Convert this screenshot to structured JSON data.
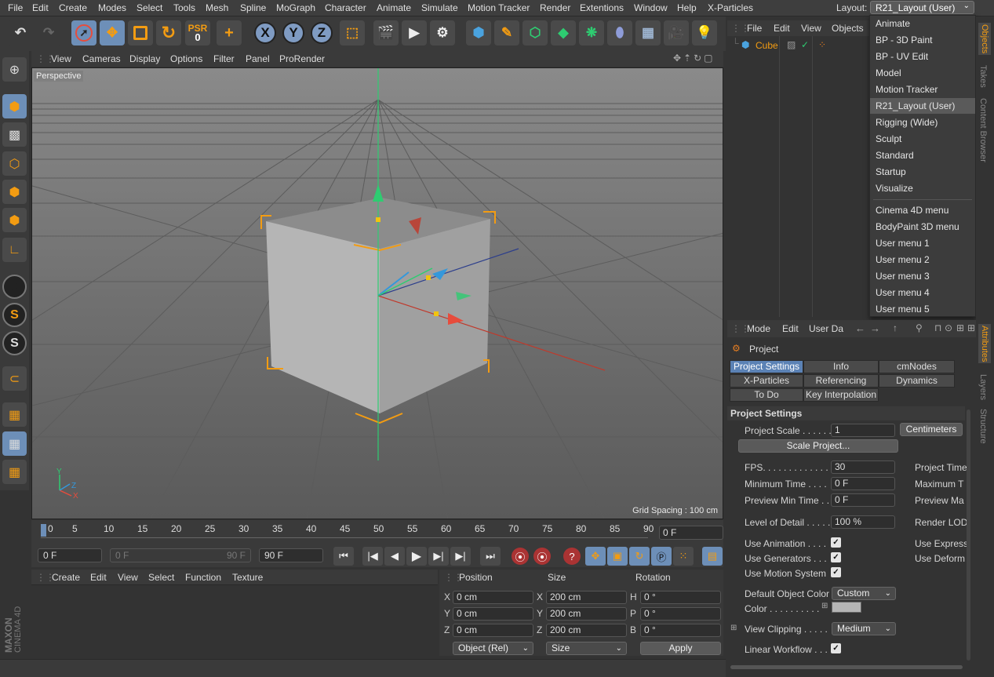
{
  "menubar": {
    "items": [
      "File",
      "Edit",
      "Create",
      "Modes",
      "Select",
      "Tools",
      "Mesh",
      "Spline",
      "MoGraph",
      "Character",
      "Animate",
      "Simulate",
      "Motion Tracker",
      "Render",
      "Extentions",
      "Window",
      "Help",
      "X-Particles"
    ],
    "layout_label": "Layout:",
    "layout_value": "R21_Layout (User)"
  },
  "layout_dropdown": {
    "items": [
      "Animate",
      "BP - 3D Paint",
      "BP - UV Edit",
      "Model",
      "Motion Tracker",
      "R21_Layout (User)",
      "Rigging (Wide)",
      "Sculpt",
      "Standard",
      "Startup",
      "Visualize"
    ],
    "active": "R21_Layout (User)",
    "menus": [
      "Cinema 4D menu",
      "BodyPaint 3D menu",
      "User menu 1",
      "User menu 2",
      "User menu 3",
      "User menu 4",
      "User menu 5"
    ]
  },
  "toolbar": {
    "psr_label": "PSR",
    "psr_value": "0",
    "axis_x": "X",
    "axis_y": "Y",
    "axis_z": "Z"
  },
  "viewport": {
    "menu": [
      "View",
      "Cameras",
      "Display",
      "Options",
      "Filter",
      "Panel",
      "ProRender"
    ],
    "label": "Perspective",
    "grid_spacing": "Grid Spacing : 100 cm",
    "axis_labels": [
      "Y",
      "Z",
      "X"
    ]
  },
  "timeline": {
    "ticks": [
      "0",
      "5",
      "10",
      "15",
      "20",
      "25",
      "30",
      "35",
      "40",
      "45",
      "50",
      "55",
      "60",
      "65",
      "70",
      "75",
      "80",
      "85",
      "90"
    ],
    "current_frame": "0 F"
  },
  "transport": {
    "start": "0 F",
    "range_start": "0 F",
    "range_end": "90 F",
    "end": "90 F"
  },
  "material_manager": {
    "menu": [
      "Create",
      "Edit",
      "View",
      "Select",
      "Function",
      "Texture"
    ]
  },
  "coordinates": {
    "headers": [
      "Position",
      "Size",
      "Rotation"
    ],
    "position": {
      "x": "0 cm",
      "y": "0 cm",
      "z": "0 cm"
    },
    "size": {
      "x": "200 cm",
      "y": "200 cm",
      "z": "200 cm"
    },
    "rotation": {
      "h": "0 °",
      "p": "0 °",
      "b": "0 °"
    },
    "axis_labels": {
      "x": "X",
      "y": "Y",
      "z": "Z",
      "h": "H",
      "p": "P",
      "b": "B"
    },
    "mode": "Object (Rel)",
    "size_mode": "Size",
    "apply": "Apply"
  },
  "brand": {
    "line1": "MAXON",
    "line2": "CINEMA 4D"
  },
  "object_manager": {
    "menu": [
      "File",
      "Edit",
      "View",
      "Objects"
    ],
    "objects": [
      {
        "name": "Cube"
      }
    ]
  },
  "side_tabs": [
    "Objects",
    "Takes",
    "Content Browser",
    "Attributes",
    "Layers",
    "Structure"
  ],
  "attributes": {
    "menu": [
      "Mode",
      "Edit",
      "User Da"
    ],
    "header": "Project",
    "tabs": [
      "Project Settings",
      "Info",
      "cmNodes",
      "X-Particles",
      "Referencing",
      "Dynamics",
      "To Do",
      "Key Interpolation"
    ],
    "section": "Project Settings",
    "project_scale_label": "Project Scale . . . . . .",
    "project_scale": "1",
    "units": "Centimeters",
    "scale_project": "Scale Project...",
    "fps_label": "FPS. . . . . . . . . . . . . .",
    "fps": "30",
    "project_time_label": "Project Time",
    "min_time_label": "Minimum Time . . . .",
    "min_time": "0 F",
    "max_time_label": "Maximum T",
    "preview_min_label": "Preview Min Time . .",
    "preview_min": "0 F",
    "preview_max_label": "Preview Ma",
    "lod_label": "Level of Detail . . . . .",
    "lod": "100 %",
    "render_lod_label": "Render LOD",
    "use_animation": "Use Animation  . . . .",
    "use_generators": "Use Generators  . . .",
    "use_motion": "Use Motion System",
    "use_express": "Use Express",
    "use_deform": "Use Deform",
    "default_color_label": "Default Object Color",
    "default_color": "Custom",
    "color_label": "Color  . . . . . . . . . .",
    "view_clipping_label": "View Clipping  . . . . .",
    "view_clipping": "Medium",
    "linear_workflow": "Linear Workflow  . . ."
  }
}
